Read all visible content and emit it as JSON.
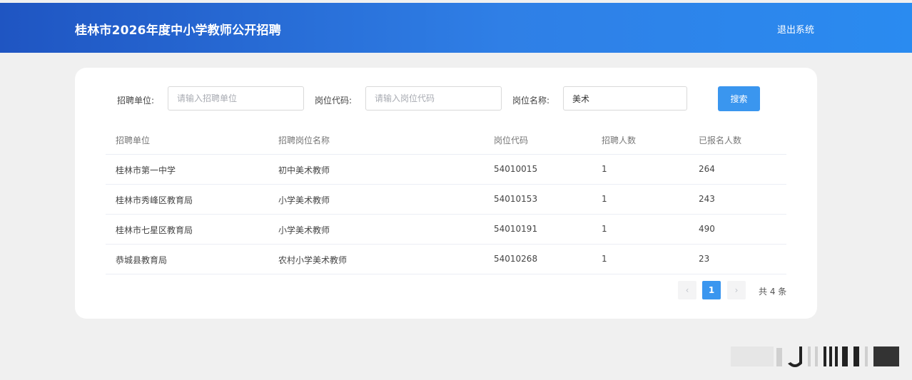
{
  "header": {
    "title": "桂林市2026年度中小学教师公开招聘",
    "logout": "退出系统"
  },
  "search": {
    "unit_label": "招聘单位:",
    "unit_placeholder": "请输入招聘单位",
    "unit_value": "",
    "code_label": "岗位代码:",
    "code_placeholder": "请输入岗位代码",
    "code_value": "",
    "name_label": "岗位名称:",
    "name_placeholder": "",
    "name_value": "美术",
    "button": "搜索"
  },
  "table": {
    "headers": [
      "招聘单位",
      "招聘岗位名称",
      "岗位代码",
      "招聘人数",
      "已报名人数"
    ],
    "rows": [
      [
        "桂林市第一中学",
        "初中美术教师",
        "54010015",
        "1",
        "264"
      ],
      [
        "桂林市秀峰区教育局",
        "小学美术教师",
        "54010153",
        "1",
        "243"
      ],
      [
        "桂林市七星区教育局",
        "小学美术教师",
        "54010191",
        "1",
        "490"
      ],
      [
        "恭城县教育局",
        "农村小学美术教师",
        "54010268",
        "1",
        "23"
      ]
    ]
  },
  "pagination": {
    "prev": "‹",
    "current": "1",
    "next": "›",
    "total": "共 4 条"
  },
  "colors": {
    "header_start": "#1f55c2",
    "header_end": "#2a8bf0",
    "accent": "#3a96ef",
    "page_bg": "#f0f0f0"
  }
}
